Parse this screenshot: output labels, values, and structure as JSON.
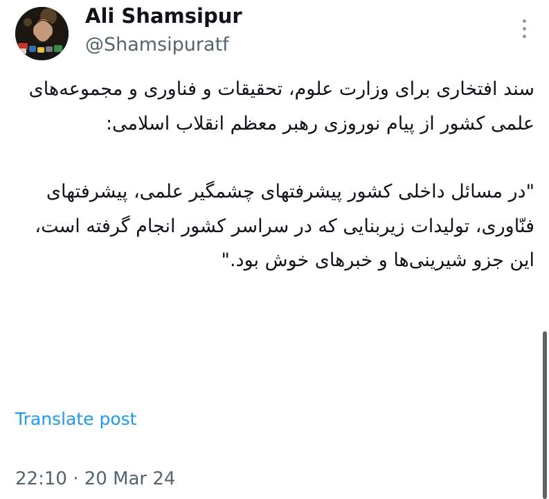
{
  "author": {
    "name": "Ali Shamsipur",
    "handle": "@Shamsipuratf"
  },
  "menu": {
    "more_icon": "more-vertical-icon"
  },
  "post": {
    "paragraph1": "سند افتخاری برای وزارت علوم، تحقیقات و فناوری و مجموعه‌های علمی کشور از پیام نوروزی رهبر معظم انقلاب اسلامی:",
    "paragraph2": "\"در مسائل داخلی کشور پیشرفتهای چشمگیر علمی، پیشرفتهای فنّاوری، تولیدات زیربنایی که در سراسر کشور انجام گرفته است، این جزو شیرینی‌ها و خبرهای خوش بود.\""
  },
  "translate_label": "Translate post",
  "timestamp": "22:10 · 20 Mar 24",
  "colors": {
    "text": "#0f1419",
    "secondary": "#536471",
    "link": "#1d9bf0",
    "background": "#ffffff"
  }
}
